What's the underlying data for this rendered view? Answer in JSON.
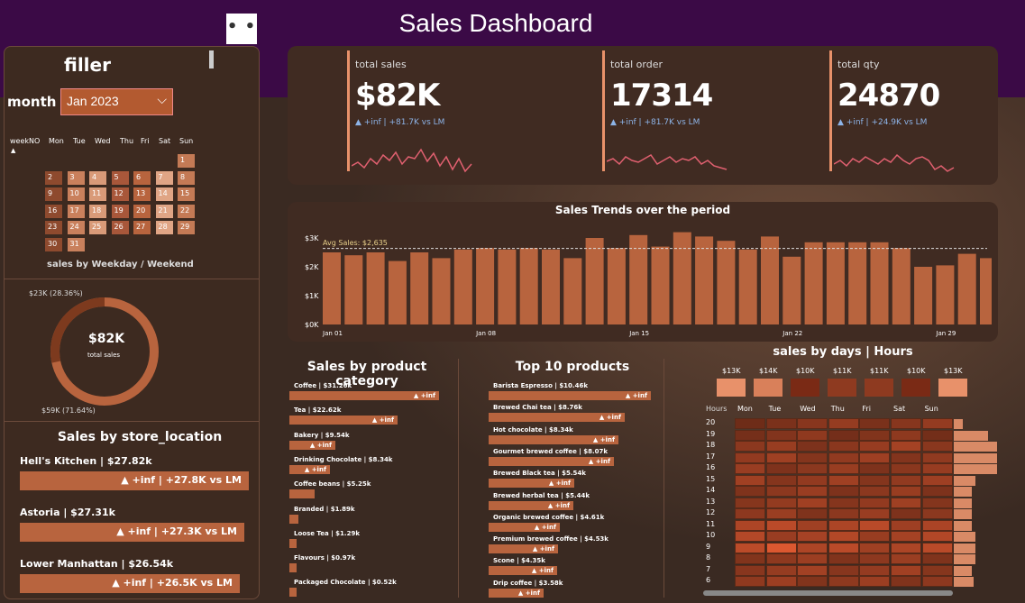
{
  "dashboard": {
    "title": "Sales Dashboard",
    "more_label": "• • •"
  },
  "filter": {
    "title": "filler",
    "month_label": "month",
    "month_value": "Jan 2023"
  },
  "calendar": {
    "headers": [
      "weekNO",
      "Mon",
      "Tue",
      "Wed",
      "Thu",
      "Fri",
      "Sat",
      "Sun"
    ],
    "days": [
      "1",
      "2",
      "3",
      "4",
      "5",
      "6",
      "7",
      "8",
      "9",
      "10",
      "11",
      "12",
      "13",
      "14",
      "15",
      "16",
      "17",
      "18",
      "19",
      "20",
      "21",
      "22",
      "23",
      "24",
      "25",
      "26",
      "27",
      "28",
      "29",
      "30",
      "31"
    ],
    "caption": "sales by Weekday / Weekend"
  },
  "donut": {
    "center_value": "$82K",
    "center_label": "total sales",
    "top_label": "$23K (28.36%)",
    "bottom_label": "$59K (71.64%)",
    "weekend_fraction": 0.2836
  },
  "store": {
    "title": "Sales by store_location",
    "items": [
      {
        "name": "Hell's Kitchen | $27.82k",
        "change": "▲ +inf | +27.8K vs LM",
        "fraction": 1.0
      },
      {
        "name": "Astoria | $27.31k",
        "change": "▲ +inf | +27.3K vs LM",
        "fraction": 0.98
      },
      {
        "name": "Lower Manhattan | $26.54k",
        "change": "▲ +inf | +26.5K vs LM",
        "fraction": 0.96
      }
    ]
  },
  "kpis": [
    {
      "title": "total sales",
      "value": "$82K",
      "sub": "▲ +inf | +81.7K vs LM"
    },
    {
      "title": "total order",
      "value": "17314",
      "sub": "▲ +inf | +81.7K vs LM"
    },
    {
      "title": "total qty",
      "value": "24870",
      "sub": "▲ +inf | +24.9K vs LM"
    }
  ],
  "trend": {
    "title": "Sales Trends over the period",
    "avg_label": "Avg Sales: $2,635",
    "y_ticks": [
      "$3K",
      "$2K",
      "$1K",
      "$0K"
    ],
    "x_ticks": [
      "Jan 01",
      "Jan 08",
      "Jan 15",
      "Jan 22",
      "Jan 29"
    ]
  },
  "category": {
    "title": "Sales by product category",
    "items": [
      {
        "label": "Coffee | $31.26k",
        "tag": "▲ +inf",
        "fraction": 1.0
      },
      {
        "label": "Tea | $22.62k",
        "tag": "▲ +inf",
        "fraction": 0.72
      },
      {
        "label": "Bakery | $9.54k",
        "tag": "▲ +inf",
        "fraction": 0.31
      },
      {
        "label": "Drinking Chocolate | $8.34k",
        "tag": "▲ +inf",
        "fraction": 0.27
      },
      {
        "label": "Coffee beans | $5.25k",
        "tag": "",
        "fraction": 0.17
      },
      {
        "label": "Branded | $1.89k",
        "tag": "",
        "fraction": 0.06
      },
      {
        "label": "Loose Tea | $1.29k",
        "tag": "",
        "fraction": 0.04
      },
      {
        "label": "Flavours | $0.97k",
        "tag": "",
        "fraction": 0.03
      },
      {
        "label": "Packaged Chocolate | $0.52k",
        "tag": "",
        "fraction": 0.02
      }
    ]
  },
  "top10": {
    "title": "Top 10 products",
    "items": [
      {
        "label": "Barista Espresso | $10.46k",
        "tag": "▲ +inf",
        "fraction": 1.0
      },
      {
        "label": "Brewed Chai tea | $8.76k",
        "tag": "▲ +inf",
        "fraction": 0.84
      },
      {
        "label": "Hot chocolate | $8.34k",
        "tag": "▲ +inf",
        "fraction": 0.8
      },
      {
        "label": "Gourmet brewed coffee | $8.07k",
        "tag": "▲ +inf",
        "fraction": 0.77
      },
      {
        "label": "Brewed Black tea | $5.54k",
        "tag": "▲ +inf",
        "fraction": 0.53
      },
      {
        "label": "Brewed herbal tea | $5.44k",
        "tag": "▲ +inf",
        "fraction": 0.52
      },
      {
        "label": "Organic brewed coffee | $4.61k",
        "tag": "▲ +inf",
        "fraction": 0.44
      },
      {
        "label": "Premium brewed coffee | $4.53k",
        "tag": "▲ +inf",
        "fraction": 0.43
      },
      {
        "label": "Scone | $4.35k",
        "tag": "▲ +inf",
        "fraction": 0.42
      },
      {
        "label": "Drip coffee | $3.58k",
        "tag": "▲ +inf",
        "fraction": 0.34
      }
    ]
  },
  "heatmap": {
    "title": "sales by days | Hours",
    "hours_label": "Hours",
    "day_totals": [
      "$13K",
      "$14K",
      "$10K",
      "$11K",
      "$11K",
      "$10K",
      "$13K"
    ],
    "days": [
      "Mon",
      "Tue",
      "Wed",
      "Thu",
      "Fri",
      "Sat",
      "Sun"
    ],
    "hours": [
      "20",
      "19",
      "18",
      "17",
      "16",
      "15",
      "14",
      "13",
      "12",
      "11",
      "10",
      "9",
      "8",
      "7",
      "6"
    ]
  }
}
